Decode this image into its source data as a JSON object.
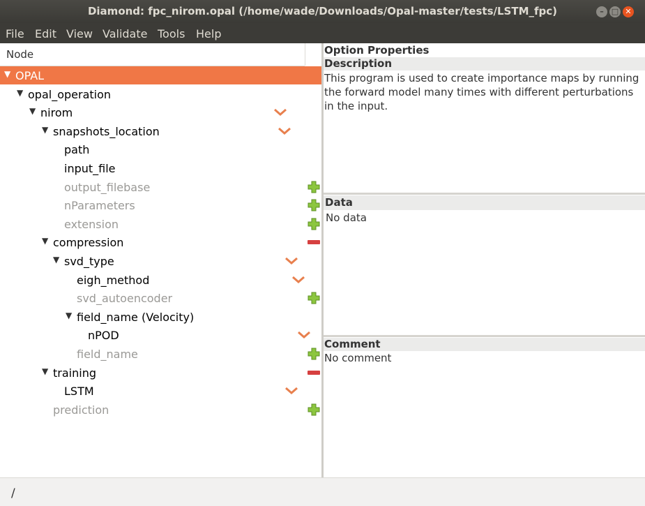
{
  "window": {
    "title": "Diamond: fpc_nirom.opal (/home/wade/Downloads/Opal-master/tests/LSTM_fpc)"
  },
  "menu": [
    "File",
    "Edit",
    "View",
    "Validate",
    "Tools",
    "Help"
  ],
  "tree": {
    "header": "Node",
    "nodes": [
      {
        "label": "OPAL",
        "expanded": true,
        "selected": true,
        "active": true,
        "action": null
      },
      {
        "label": "opal_operation",
        "expanded": true,
        "active": true,
        "action": null
      },
      {
        "label": "nirom",
        "expanded": true,
        "active": true,
        "action": "choice"
      },
      {
        "label": "snapshots_location",
        "expanded": true,
        "active": true,
        "action": "choice"
      },
      {
        "label": "path",
        "expanded": null,
        "active": true,
        "action": null
      },
      {
        "label": "input_file",
        "expanded": null,
        "active": true,
        "action": null
      },
      {
        "label": "output_filebase",
        "expanded": null,
        "active": false,
        "action": "add"
      },
      {
        "label": "nParameters",
        "expanded": null,
        "active": false,
        "action": "add"
      },
      {
        "label": "extension",
        "expanded": null,
        "active": false,
        "action": "add"
      },
      {
        "label": "compression",
        "expanded": true,
        "active": true,
        "action": "remove"
      },
      {
        "label": "svd_type",
        "expanded": true,
        "active": true,
        "action": "choice"
      },
      {
        "label": "eigh_method",
        "expanded": null,
        "active": true,
        "action": "choice"
      },
      {
        "label": "svd_autoencoder",
        "expanded": null,
        "active": false,
        "action": "add"
      },
      {
        "label": "field_name (Velocity)",
        "expanded": true,
        "active": true,
        "action": null
      },
      {
        "label": "nPOD",
        "expanded": null,
        "active": true,
        "action": "choice"
      },
      {
        "label": "field_name",
        "expanded": null,
        "active": false,
        "action": "add"
      },
      {
        "label": "training",
        "expanded": true,
        "active": true,
        "action": "remove"
      },
      {
        "label": "LSTM",
        "expanded": null,
        "active": true,
        "action": "choice"
      },
      {
        "label": "prediction",
        "expanded": null,
        "active": false,
        "action": "add"
      }
    ]
  },
  "properties": {
    "option_title": "Option Properties",
    "description_title": "Description",
    "description_text": " This program is used to create importance maps by running the forward  model many times with different perturbations in the input.",
    "data_title": "Data",
    "data_text": "No data",
    "comment_title": "Comment",
    "comment_text": "No comment"
  },
  "status": {
    "path": "/"
  },
  "colors": {
    "selection": "#f07746",
    "chevron": "#e8804e",
    "add": "#8cc63f",
    "remove": "#d64040",
    "close": "#e95420"
  }
}
